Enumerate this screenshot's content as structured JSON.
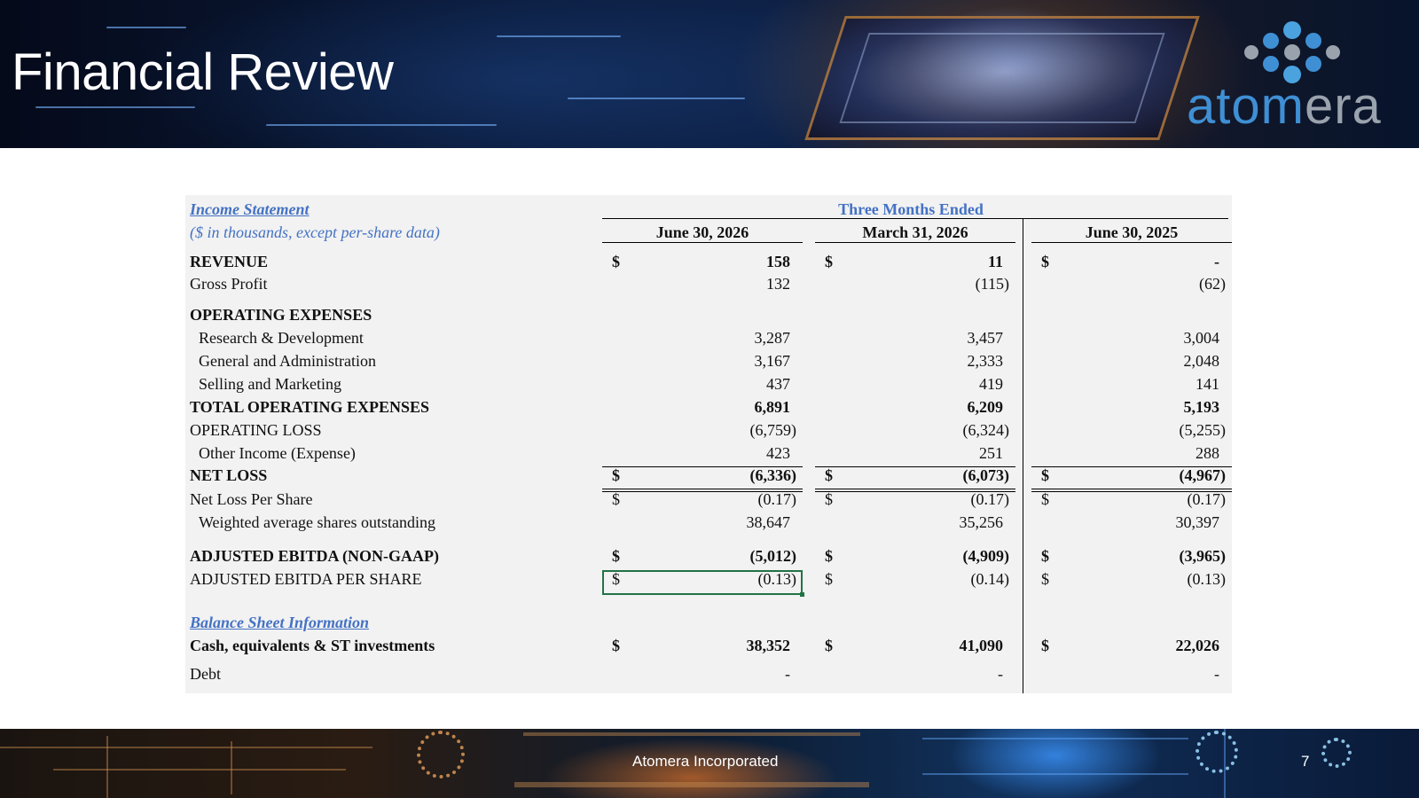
{
  "slide": {
    "title": "Financial Review",
    "page_number": "7",
    "footer_text": "Atomera Incorporated",
    "logo_text_part1": "atom",
    "logo_text_part2": "era",
    "colors": {
      "accent_blue": "#4472c4",
      "logo_blue": "#3f8fd4",
      "logo_gray": "#9aa3ad",
      "selection_green": "#217346"
    }
  },
  "income_statement": {
    "heading": "Income Statement",
    "units_note": "($ in thousands, except per-share data)",
    "group_header": "Three Months Ended",
    "columns": [
      "June 30, 2026",
      "March 31, 2026",
      "June 30, 2025"
    ],
    "rows": {
      "revenue": {
        "label": "REVENUE",
        "values": [
          "158",
          "11",
          "-"
        ],
        "dollar": "$"
      },
      "gross_profit": {
        "label": "Gross Profit",
        "values": [
          "132",
          "(115)",
          "(62)"
        ]
      },
      "opex_heading": {
        "label": "OPERATING EXPENSES"
      },
      "rnd": {
        "label": "Research & Development",
        "values": [
          "3,287",
          "3,457",
          "3,004"
        ]
      },
      "gna": {
        "label": "General and Administration",
        "values": [
          "3,167",
          "2,333",
          "2,048"
        ]
      },
      "snm": {
        "label": "Selling and Marketing",
        "values": [
          "437",
          "419",
          "141"
        ]
      },
      "total_opex": {
        "label": "TOTAL OPERATING EXPENSES",
        "values": [
          "6,891",
          "6,209",
          "5,193"
        ]
      },
      "op_loss": {
        "label": "OPERATING LOSS",
        "values": [
          "(6,759)",
          "(6,324)",
          "(5,255)"
        ]
      },
      "other_income": {
        "label": "Other Income (Expense)",
        "values": [
          "423",
          "251",
          "288"
        ]
      },
      "net_loss": {
        "label": "NET LOSS",
        "values": [
          "(6,336)",
          "(6,073)",
          "(4,967)"
        ],
        "dollar": "$"
      },
      "nl_per_share": {
        "label": "Net Loss Per Share",
        "values": [
          "(0.17)",
          "(0.17)",
          "(0.17)"
        ],
        "dollar": "$"
      },
      "wavg_shares": {
        "label": "Weighted average shares outstanding",
        "values": [
          "38,647",
          "35,256",
          "30,397"
        ]
      },
      "adj_ebitda": {
        "label": "ADJUSTED EBITDA (NON-GAAP)",
        "values": [
          "(5,012)",
          "(4,909)",
          "(3,965)"
        ],
        "dollar": "$"
      },
      "adj_ebitda_ps": {
        "label": "ADJUSTED EBITDA PER SHARE",
        "values": [
          "(0.13)",
          "(0.14)",
          "(0.13)"
        ],
        "dollar": "$"
      }
    }
  },
  "balance_sheet": {
    "heading": "Balance Sheet Information",
    "rows": {
      "cash": {
        "label": "Cash, equivalents & ST investments",
        "values": [
          "38,352",
          "41,090",
          "22,026"
        ],
        "dollar": "$"
      },
      "debt": {
        "label": "Debt",
        "values": [
          "-",
          "-",
          "-"
        ]
      }
    }
  }
}
